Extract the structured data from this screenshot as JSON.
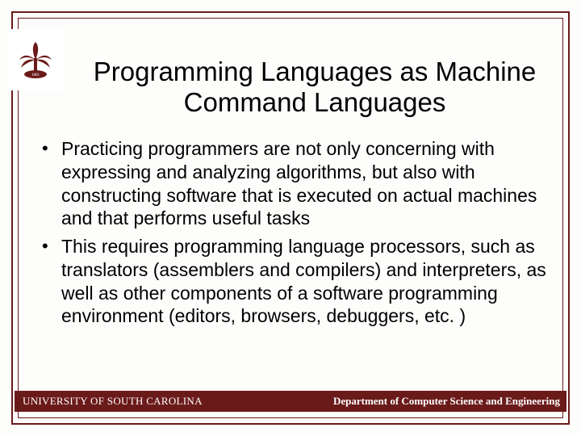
{
  "title": "Programming Languages as Machine Command Languages",
  "bullets": [
    "Practicing programmers are not only concerning with expressing and analyzing algorithms, but also with constructing software that is executed on actual machines and that performs useful tasks",
    "This requires programming language processors, such as translators (assemblers and compilers) and interpreters, as well as other components of a software programming environment (editors, browsers, debuggers, etc. )"
  ],
  "footer": {
    "left": "UNIVERSITY OF SOUTH CAROLINA",
    "right": "Department of Computer Science and Engineering"
  },
  "colors": {
    "maroon": "#6b1a1a"
  }
}
